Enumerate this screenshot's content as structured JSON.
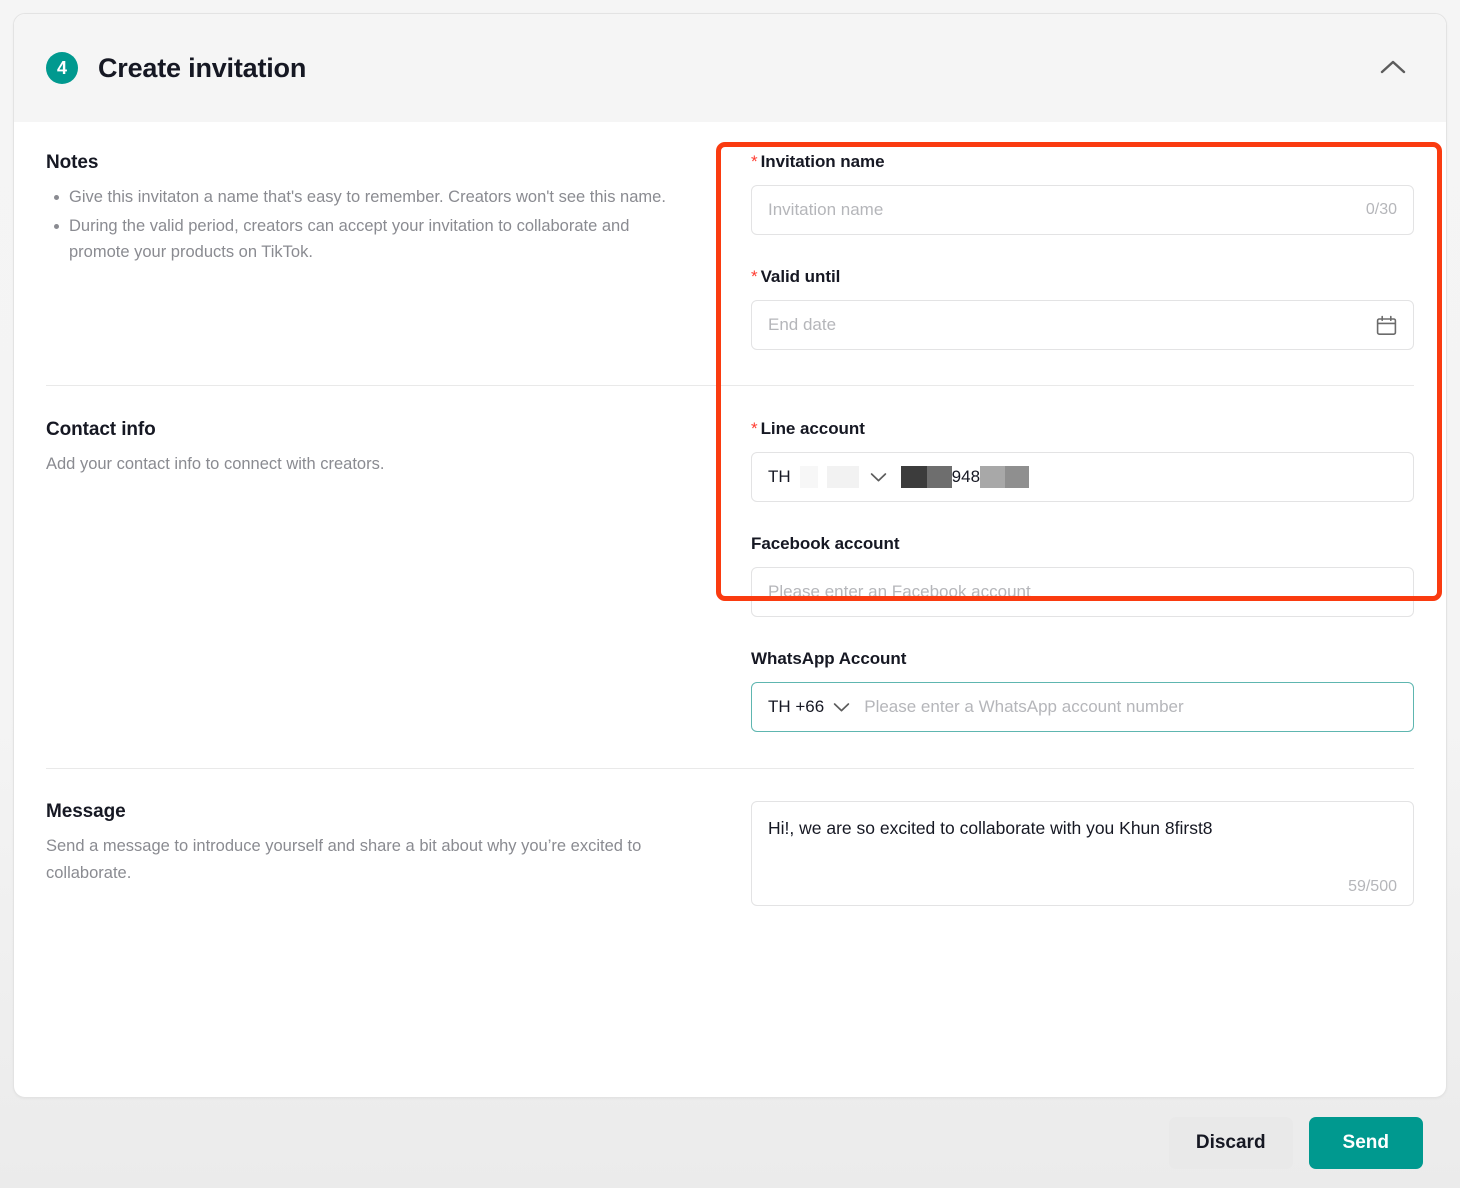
{
  "header": {
    "step_number": "4",
    "title": "Create invitation",
    "collapse_icon": "chevron-up-icon"
  },
  "notes": {
    "title": "Notes",
    "items": [
      "Give this invitaton a name that's easy to remember. Creators won't see this name.",
      "During the valid period, creators can accept your invitation to collaborate and promote your products on TikTok."
    ]
  },
  "contact_info": {
    "title": "Contact info",
    "subtitle": "Add your contact info to connect with creators."
  },
  "message_block": {
    "title": "Message",
    "subtitle": "Send a message to introduce yourself and share a bit about why you’re excited to collaborate."
  },
  "form": {
    "invitation_name": {
      "label": "Invitation name",
      "required_mark": "*",
      "placeholder": "Invitation name",
      "value": "",
      "counter": "0/30"
    },
    "valid_until": {
      "label": "Valid until",
      "required_mark": "*",
      "placeholder": "End date",
      "value": "",
      "icon": "calendar-icon"
    },
    "line_account": {
      "label": "Line account",
      "required_mark": "*",
      "country_code": "TH",
      "country_code_redacted": true,
      "value_visible": "948",
      "value_redacted": true,
      "dropdown_icon": "chevron-down-icon"
    },
    "facebook_account": {
      "label": "Facebook account",
      "placeholder": "Please enter an Facebook account",
      "value": ""
    },
    "whatsapp_account": {
      "label": "WhatsApp Account",
      "country_code": "TH +66",
      "placeholder": "Please enter a WhatsApp account number",
      "value": "",
      "dropdown_icon": "chevron-down-icon",
      "focused": true
    },
    "message": {
      "value": "Hi!, we are so excited to collaborate with you Khun 8first8",
      "counter": "59/500"
    }
  },
  "footer": {
    "discard_label": "Discard",
    "send_label": "Send"
  },
  "colors": {
    "accent_teal": "#00998f",
    "required_red": "#ff3b30",
    "highlight_red": "#fa3b10",
    "header_bg": "#f5f5f5",
    "border": "#e3e3e4",
    "placeholder": "#b5b6ba",
    "muted_text": "#8a8b91",
    "primary_text": "#161823",
    "discard_bg": "#e9e9e9"
  }
}
